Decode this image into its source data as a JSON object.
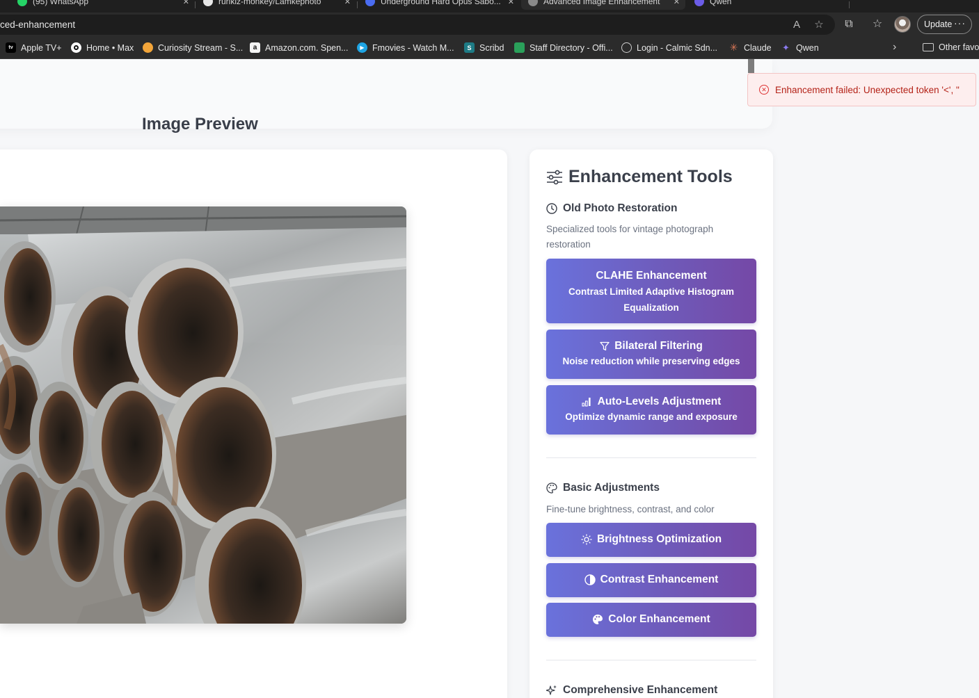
{
  "browser": {
    "tabs": [
      {
        "title": "(95) WhatsApp",
        "icon": "whatsapp-icon"
      },
      {
        "title": "rurikiz-monkey/Lamkephoto",
        "icon": "github-icon"
      },
      {
        "title": "Underground Hard Opus Sabo...",
        "icon": "google-icon"
      },
      {
        "title": "Advanced Image Enhancement",
        "icon": "globe-icon",
        "active": true
      },
      {
        "title": "Qwen",
        "icon": "qwen-icon"
      }
    ],
    "url": "ced-enhancement",
    "update_label": "Update",
    "favorites": [
      {
        "label": "Apple TV+",
        "icon": "appletv-icon",
        "color": "#000000"
      },
      {
        "label": "Home • Max",
        "icon": "max-icon",
        "color": "#111111"
      },
      {
        "label": "Curiosity Stream - S...",
        "icon": "curiosity-icon",
        "color": "#f2a53a"
      },
      {
        "label": "Amazon.com. Spen...",
        "icon": "amazon-icon",
        "color": "#f5f5f5"
      },
      {
        "label": "Fmovies - Watch M...",
        "icon": "fmovies-icon",
        "color": "#1ea4e3"
      },
      {
        "label": "Scribd",
        "icon": "scribd-icon",
        "color": "#1e7b85"
      },
      {
        "label": "Staff Directory - Offi...",
        "icon": "staff-icon",
        "color": "#2aa05a"
      },
      {
        "label": "Login - Calmic Sdn...",
        "icon": "globe-icon",
        "color": "#cfcfcf"
      },
      {
        "label": "Claude",
        "icon": "claude-icon",
        "color": "#d97757"
      },
      {
        "label": "Qwen",
        "icon": "qwen-icon",
        "color": "#6b5ce7"
      }
    ],
    "other_favorites": "Other favo"
  },
  "toast": {
    "message": "Enhancement failed: Unexpected token '<', \""
  },
  "preview": {
    "title": "Image Preview"
  },
  "tools": {
    "title": "Enhancement Tools",
    "sections": [
      {
        "heading": "Old Photo Restoration",
        "description": "Specialized tools for vintage photograph restoration",
        "buttons": [
          {
            "label": "CLAHE Enhancement",
            "sub": "Contrast Limited Adaptive Histogram Equalization"
          },
          {
            "label": "Bilateral Filtering",
            "sub": "Noise reduction while preserving edges",
            "icon": "filter-icon"
          },
          {
            "label": "Auto-Levels Adjustment",
            "sub": "Optimize dynamic range and exposure",
            "icon": "bar-chart-icon"
          }
        ]
      },
      {
        "heading": "Basic Adjustments",
        "description": "Fine-tune brightness, contrast, and color",
        "buttons": [
          {
            "label": "Brightness Optimization",
            "icon": "sun-icon"
          },
          {
            "label": "Contrast Enhancement",
            "icon": "contrast-icon"
          },
          {
            "label": "Color Enhancement",
            "icon": "palette-icon"
          }
        ]
      },
      {
        "heading": "Comprehensive Enhancement"
      }
    ]
  },
  "colors": {
    "button_gradient_start": "#6a72dc",
    "button_gradient_end": "#7548a6",
    "error_text": "#b42318",
    "error_bg": "#fdeeee"
  }
}
